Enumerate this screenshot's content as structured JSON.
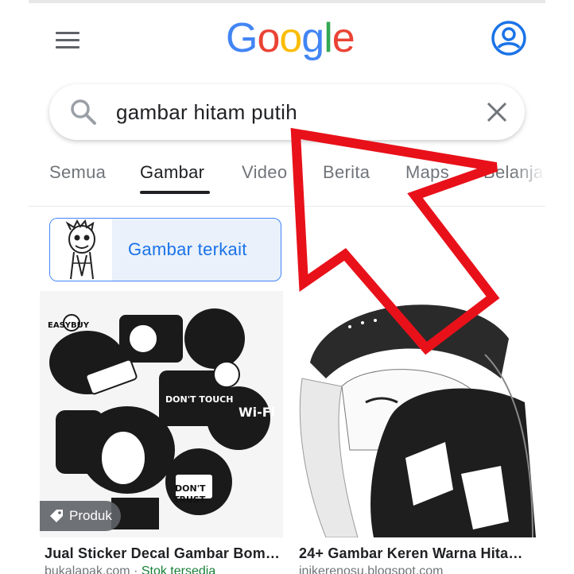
{
  "header": {
    "logo_letters": [
      {
        "char": "G",
        "color": "#4285F4"
      },
      {
        "char": "o",
        "color": "#EA4335"
      },
      {
        "char": "o",
        "color": "#FBBC05"
      },
      {
        "char": "g",
        "color": "#4285F4"
      },
      {
        "char": "l",
        "color": "#34A853"
      },
      {
        "char": "e",
        "color": "#EA4335"
      }
    ],
    "menu_icon": "hamburger-menu-icon",
    "account_icon": "account-circle-icon"
  },
  "search": {
    "query": "gambar hitam putih",
    "search_icon": "search-icon",
    "clear_icon": "close-icon"
  },
  "tabs": [
    {
      "label": "Semua",
      "active": false
    },
    {
      "label": "Gambar",
      "active": true
    },
    {
      "label": "Video",
      "active": false
    },
    {
      "label": "Berita",
      "active": false
    },
    {
      "label": "Maps",
      "active": false
    },
    {
      "label": "Belanja",
      "active": false
    }
  ],
  "related": {
    "label": "Gambar terkait"
  },
  "results": [
    {
      "badge": "Produk",
      "title": "Jual Sticker Decal Gambar Bomb...",
      "source": "bukalapak.com",
      "separator": " · ",
      "stock": "Stok tersedia"
    },
    {
      "title": "24+ Gambar Keren Warna Hitam ...",
      "source": "inikerenosu.blogspot.com"
    }
  ],
  "colors": {
    "accent": "#1a73e8",
    "annotation_arrow": "#e8111a",
    "stock_green": "#188038"
  }
}
